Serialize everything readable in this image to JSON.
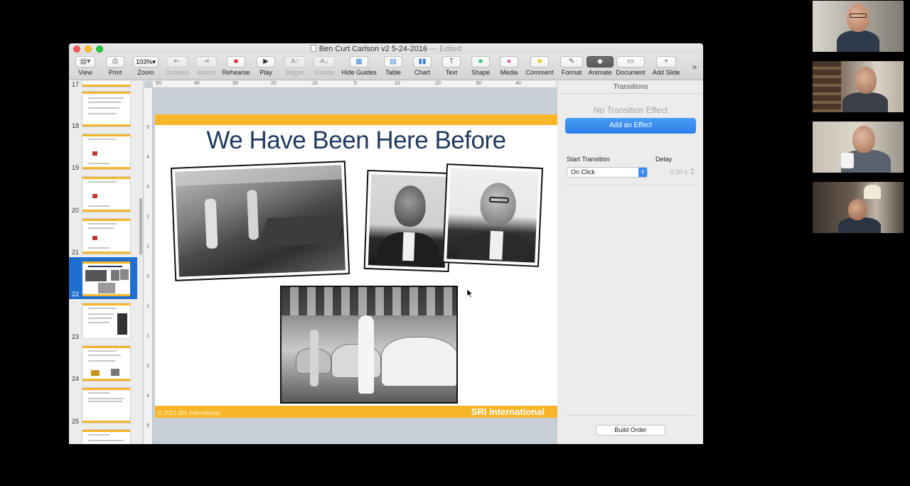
{
  "window": {
    "title": "Ben Curt Carlson v2   5-24-2016",
    "edited": "— Edited"
  },
  "toolbar": {
    "zoom_value": "103%",
    "items": [
      {
        "label": "View",
        "icon": "view-icon"
      },
      {
        "label": "Print",
        "icon": "print-icon"
      },
      {
        "label": "Zoom",
        "icon": "zoom-icon"
      },
      {
        "label": "Outdent",
        "icon": "outdent-icon"
      },
      {
        "label": "Indent",
        "icon": "indent-icon"
      },
      {
        "label": "Rehearse",
        "icon": "rehearse-icon"
      },
      {
        "label": "Play",
        "icon": "play-icon"
      },
      {
        "label": "Bigger",
        "icon": "bigger-icon"
      },
      {
        "label": "Smaller",
        "icon": "smaller-icon"
      },
      {
        "label": "Hide Guides",
        "icon": "guides-icon"
      },
      {
        "label": "Table",
        "icon": "table-icon"
      },
      {
        "label": "Chart",
        "icon": "chart-icon"
      },
      {
        "label": "Text",
        "icon": "text-icon"
      },
      {
        "label": "Shape",
        "icon": "shape-icon"
      },
      {
        "label": "Media",
        "icon": "media-icon"
      },
      {
        "label": "Comment",
        "icon": "comment-icon"
      },
      {
        "label": "Format",
        "icon": "format-icon"
      },
      {
        "label": "Animate",
        "icon": "animate-icon"
      },
      {
        "label": "Document",
        "icon": "document-icon"
      },
      {
        "label": "Add Slide",
        "icon": "add-slide-icon"
      }
    ],
    "overflow": "»"
  },
  "navigator": {
    "slides": [
      {
        "number": "17"
      },
      {
        "number": "18"
      },
      {
        "number": "19"
      },
      {
        "number": "20"
      },
      {
        "number": "21"
      },
      {
        "number": "22",
        "selected": true
      },
      {
        "number": "23"
      },
      {
        "number": "24"
      },
      {
        "number": "25"
      }
    ]
  },
  "ruler": {
    "h_ticks": [
      "50",
      "40",
      "30",
      "20",
      "10",
      "0",
      "10",
      "20",
      "30",
      "40"
    ],
    "v_ticks": [
      "5",
      "4",
      "3",
      "2",
      "1",
      "0",
      "1",
      "2",
      "3",
      "4",
      "5"
    ]
  },
  "slide": {
    "title": "We Have Been Here Before",
    "copyright": "© 2013 SRI International",
    "logo_text": "SRI International",
    "accent_color": "#f7b52a",
    "title_color": "#1f3a5f"
  },
  "inspector": {
    "header": "Transitions",
    "no_transition": "No Transition Effect",
    "add_effect": "Add an Effect",
    "start_transition_label": "Start Transition",
    "start_transition_value": "On Click",
    "delay_label": "Delay",
    "delay_value": "0.50 s",
    "build_order": "Build Order"
  }
}
